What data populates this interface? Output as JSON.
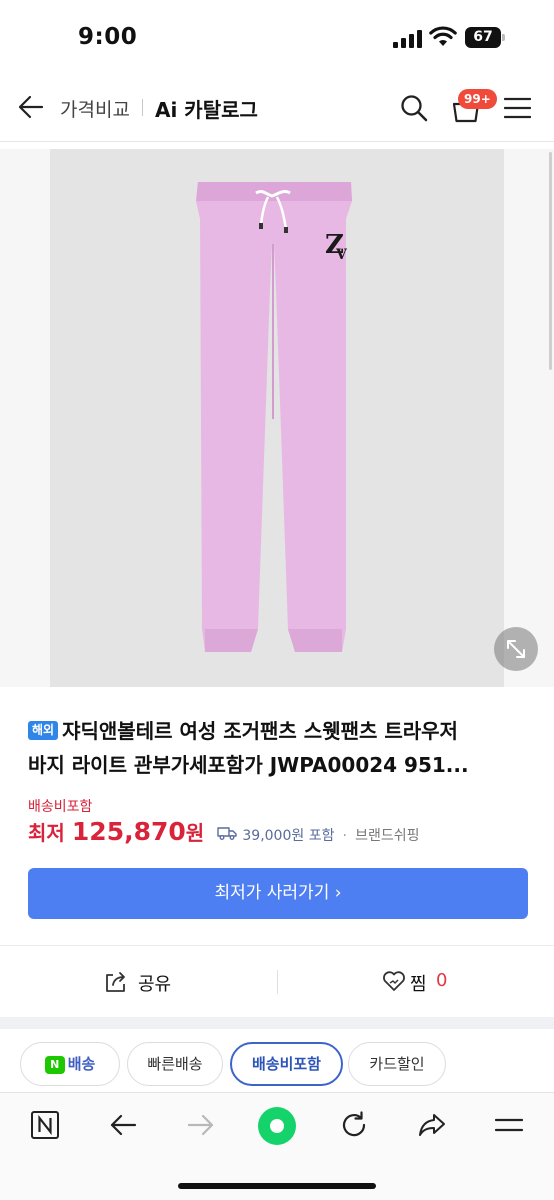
{
  "status_bar": {
    "time": "9:00",
    "battery": "67"
  },
  "header": {
    "breadcrumb_1": "가격비교",
    "breadcrumb_2": "Ai 카탈로그",
    "cart_badge": "99+"
  },
  "product": {
    "image_alt": "핑크 조거팬츠",
    "tag": "해외",
    "title_line1": "쟈딕앤볼테르 여성 조거팬츠 스웻팬츠 트라우저",
    "title_line2": "바지 라이트 관부가세포함가 JWPA00024 951...",
    "shipping_included": "배송비포함",
    "price_label": "최저",
    "price_value": "125,870",
    "price_unit": "원",
    "shipping_fee": "39,000원 포함",
    "seller": "브랜드쉬핑",
    "cta": "최저가 사러가기 ›"
  },
  "actions": {
    "share": "공유",
    "like": "찜",
    "like_count": "0"
  },
  "chips": [
    {
      "badge": "N",
      "label": "배송"
    },
    {
      "label": "빠른배송"
    },
    {
      "label": "배송비포함"
    },
    {
      "label": "카드할인"
    }
  ],
  "colors": {
    "accent": "#4d7ef2",
    "price": "#d8233a",
    "tag": "#2f86e8",
    "naver_green": "#1ec800",
    "product_pink": "#e8b8e4"
  }
}
